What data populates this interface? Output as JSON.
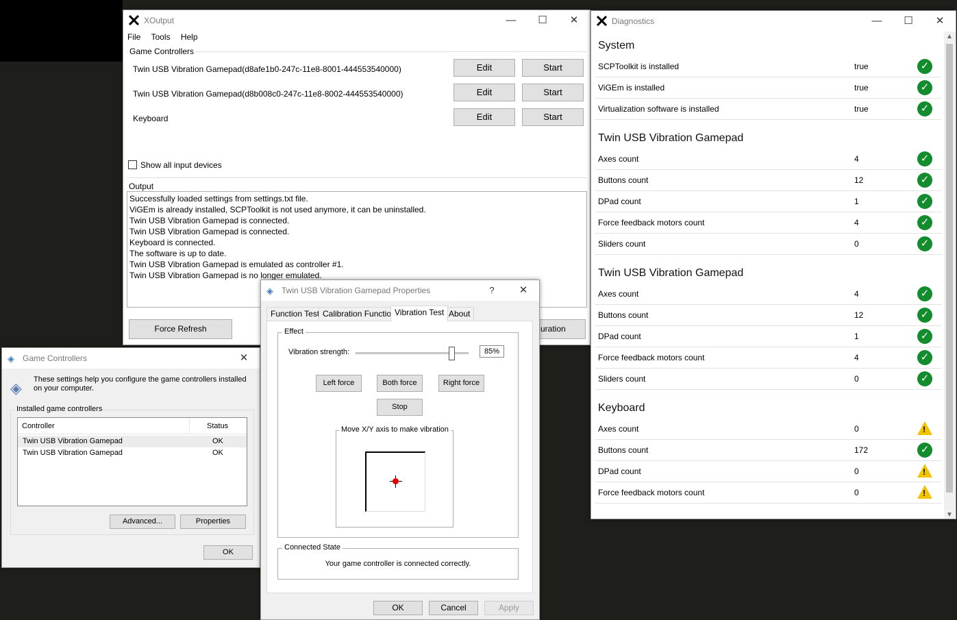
{
  "xoutput": {
    "title": "XOutput",
    "menu": [
      "File",
      "Tools",
      "Help"
    ],
    "controllers_label": "Game Controllers",
    "controllers": [
      {
        "name": "Twin USB Vibration Gamepad(d8afe1b0-247c-11e8-8001-444553540000)",
        "edit": "Edit",
        "start": "Start"
      },
      {
        "name": "Twin USB Vibration Gamepad(d8b008c0-247c-11e8-8002-444553540000)",
        "edit": "Edit",
        "start": "Start"
      },
      {
        "name": "Keyboard",
        "edit": "Edit",
        "start": "Start"
      }
    ],
    "show_all_label": "Show all input devices",
    "output_label": "Output",
    "log": [
      "Successfully loaded settings from settings.txt file.",
      "ViGEm is already installed, SCPToolkit is not used anymore, it can be uninstalled.",
      "Twin USB Vibration Gamepad is connected.",
      "Twin USB Vibration Gamepad is connected.",
      "Keyboard is connected.",
      "The software is up to date.",
      "Twin USB Vibration Gamepad is emulated as controller #1.",
      "Twin USB Vibration Gamepad is no longer emulated."
    ],
    "force_refresh": "Force Refresh",
    "config_partial": "uration"
  },
  "diagnostics": {
    "title": "Diagnostics",
    "sections": [
      {
        "title": "System",
        "rows": [
          {
            "label": "SCPToolkit is installed",
            "value": "true",
            "status": "ok"
          },
          {
            "label": "ViGEm is installed",
            "value": "true",
            "status": "ok"
          },
          {
            "label": "Virtualization software is installed",
            "value": "true",
            "status": "ok"
          }
        ]
      },
      {
        "title": "Twin USB Vibration Gamepad",
        "rows": [
          {
            "label": "Axes count",
            "value": "4",
            "status": "ok"
          },
          {
            "label": "Buttons count",
            "value": "12",
            "status": "ok"
          },
          {
            "label": "DPad count",
            "value": "1",
            "status": "ok"
          },
          {
            "label": "Force feedback motors count",
            "value": "4",
            "status": "ok"
          },
          {
            "label": "Sliders count",
            "value": "0",
            "status": "ok"
          }
        ]
      },
      {
        "title": "Twin USB Vibration Gamepad",
        "rows": [
          {
            "label": "Axes count",
            "value": "4",
            "status": "ok"
          },
          {
            "label": "Buttons count",
            "value": "12",
            "status": "ok"
          },
          {
            "label": "DPad count",
            "value": "1",
            "status": "ok"
          },
          {
            "label": "Force feedback motors count",
            "value": "4",
            "status": "ok"
          },
          {
            "label": "Sliders count",
            "value": "0",
            "status": "ok"
          }
        ]
      },
      {
        "title": "Keyboard",
        "rows": [
          {
            "label": "Axes count",
            "value": "0",
            "status": "warning"
          },
          {
            "label": "Buttons count",
            "value": "172",
            "status": "ok"
          },
          {
            "label": "DPad count",
            "value": "0",
            "status": "warning"
          },
          {
            "label": "Force feedback motors count",
            "value": "0",
            "status": "warning"
          }
        ]
      }
    ]
  },
  "game_controllers": {
    "title": "Game Controllers",
    "description": "These settings help you configure the game controllers installed on your computer.",
    "installed_label": "Installed game controllers",
    "col_controller": "Controller",
    "col_status": "Status",
    "items": [
      {
        "name": "Twin USB Vibration Gamepad",
        "status": "OK"
      },
      {
        "name": "Twin USB Vibration Gamepad",
        "status": "OK"
      }
    ],
    "advanced": "Advanced...",
    "properties": "Properties",
    "ok": "OK"
  },
  "properties": {
    "title": "Twin USB Vibration Gamepad Properties",
    "help": "?",
    "tabs": [
      "Function Test",
      "Calibration Function",
      "Vibration Test",
      "About"
    ],
    "selected_tab": "Vibration Test",
    "effect_label": "Effect",
    "strength_label": "Vibration strength:",
    "strength_value": "85%",
    "strength_fraction": 0.85,
    "left_force": "Left force",
    "both_force": "Both force",
    "right_force": "Right force",
    "stop": "Stop",
    "xy_label": "Move X/Y axis to make vibration",
    "connected_label": "Connected State",
    "connected_text": "Your game controller is connected correctly.",
    "ok": "OK",
    "cancel": "Cancel",
    "apply": "Apply"
  },
  "colors": {
    "ok": "#128c2c",
    "warning": "#f2c300",
    "accent": "#0078d7"
  }
}
